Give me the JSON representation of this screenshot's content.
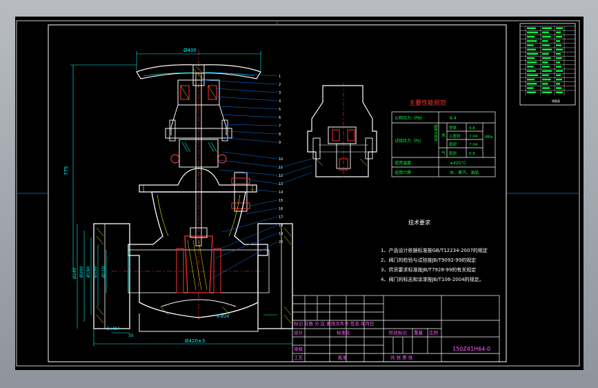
{
  "colors": {
    "background": "#000000",
    "outline": "#ffffff",
    "dimension": "#00ffff",
    "section": "#ff3030",
    "hatch": "#ffff00",
    "title": "#ff60ff",
    "leader": "#0080ff",
    "table_line": "#ffffff"
  },
  "drawing": {
    "dim_top": "Ø400",
    "dim_height": "775",
    "dim_flange": "Ø240",
    "dim_d1": "Ø200",
    "dim_d2": "Ø160",
    "dim_d3": "Ø150",
    "dim_d4": "Ø110",
    "dim_bolts": "8-Ø26",
    "dim_bottom": "Ø420±3",
    "dim_seal": "3×45°",
    "dim_thick": "35",
    "part_numbers": [
      "1",
      "2",
      "3",
      "4",
      "5",
      "6",
      "7",
      "8",
      "9",
      "10",
      "11",
      "12",
      "13",
      "14",
      "15",
      "16",
      "17",
      "18",
      "19",
      "20"
    ]
  },
  "performance": {
    "title": "主要性能规范",
    "rows": [
      {
        "label": "公称压力（PN）",
        "value": "6.4"
      },
      {
        "label": "试验压力（Ps）",
        "sub": [
          {
            "group": "水",
            "name": "壳体",
            "value": "9.6"
          },
          {
            "group": "水",
            "name": "上密封",
            "value": "7.04"
          },
          {
            "group": "水",
            "name": "密封",
            "value": "7.04"
          },
          {
            "group": "气",
            "name": "密封",
            "value": "0.6"
          }
        ],
        "unit": "MPa"
      },
      {
        "label": "适用温度",
        "value": "≤425°C"
      },
      {
        "label": "适用介质",
        "value": "水、蒸汽、油品"
      }
    ],
    "side_label": "强度与密封"
  },
  "tech": {
    "title": "技术要求",
    "items": [
      "1、产品设计依据标准按GB/T12234-2007的规定",
      "2、阀门的检验与试验按JB/T9092-99的规定",
      "3、供货要求标准按JB/T7928-99的有关规定",
      "4、阀门的标志和涂漆按JB/T106-2004的规定。"
    ]
  },
  "titleblock": {
    "row1": "标记 处数 分 区 更改文件号 签名 年月日",
    "designer": "设计",
    "standardize": "标准化",
    "stage": "阶段标记",
    "weight": "重量",
    "scale": "比例",
    "check": "审核",
    "process": "工艺",
    "approve": "批准",
    "sheets": "共  张  第  张",
    "code": "150Z41H64-0"
  },
  "parts_list": {
    "rows": 16,
    "footer": "明细表"
  }
}
